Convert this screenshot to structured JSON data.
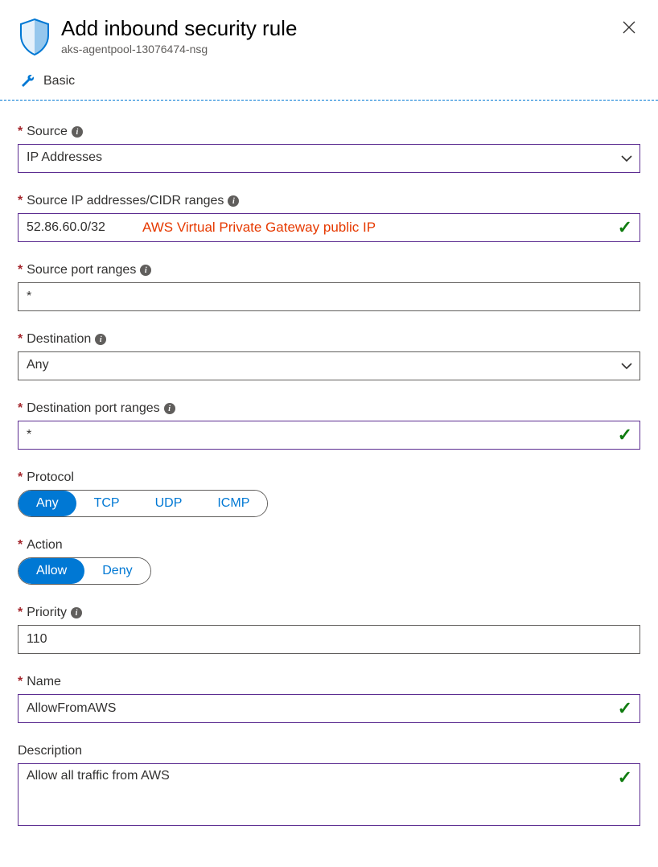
{
  "header": {
    "title": "Add inbound security rule",
    "subtitle": "aks-agentpool-13076474-nsg"
  },
  "mode": {
    "basic_label": "Basic"
  },
  "form": {
    "source": {
      "label": "Source",
      "value": "IP Addresses"
    },
    "source_ip": {
      "label": "Source IP addresses/CIDR ranges",
      "value": "52.86.60.0/32",
      "annotation": "AWS Virtual Private Gateway public IP"
    },
    "source_port": {
      "label": "Source port ranges",
      "value": "*"
    },
    "destination": {
      "label": "Destination",
      "value": "Any"
    },
    "dest_port": {
      "label": "Destination port ranges",
      "value": "*"
    },
    "protocol": {
      "label": "Protocol",
      "options": [
        "Any",
        "TCP",
        "UDP",
        "ICMP"
      ],
      "selected": "Any"
    },
    "action": {
      "label": "Action",
      "options": [
        "Allow",
        "Deny"
      ],
      "selected": "Allow"
    },
    "priority": {
      "label": "Priority",
      "value": "110"
    },
    "name": {
      "label": "Name",
      "value": "AllowFromAWS"
    },
    "description": {
      "label": "Description",
      "value": "Allow all traffic from AWS"
    }
  }
}
